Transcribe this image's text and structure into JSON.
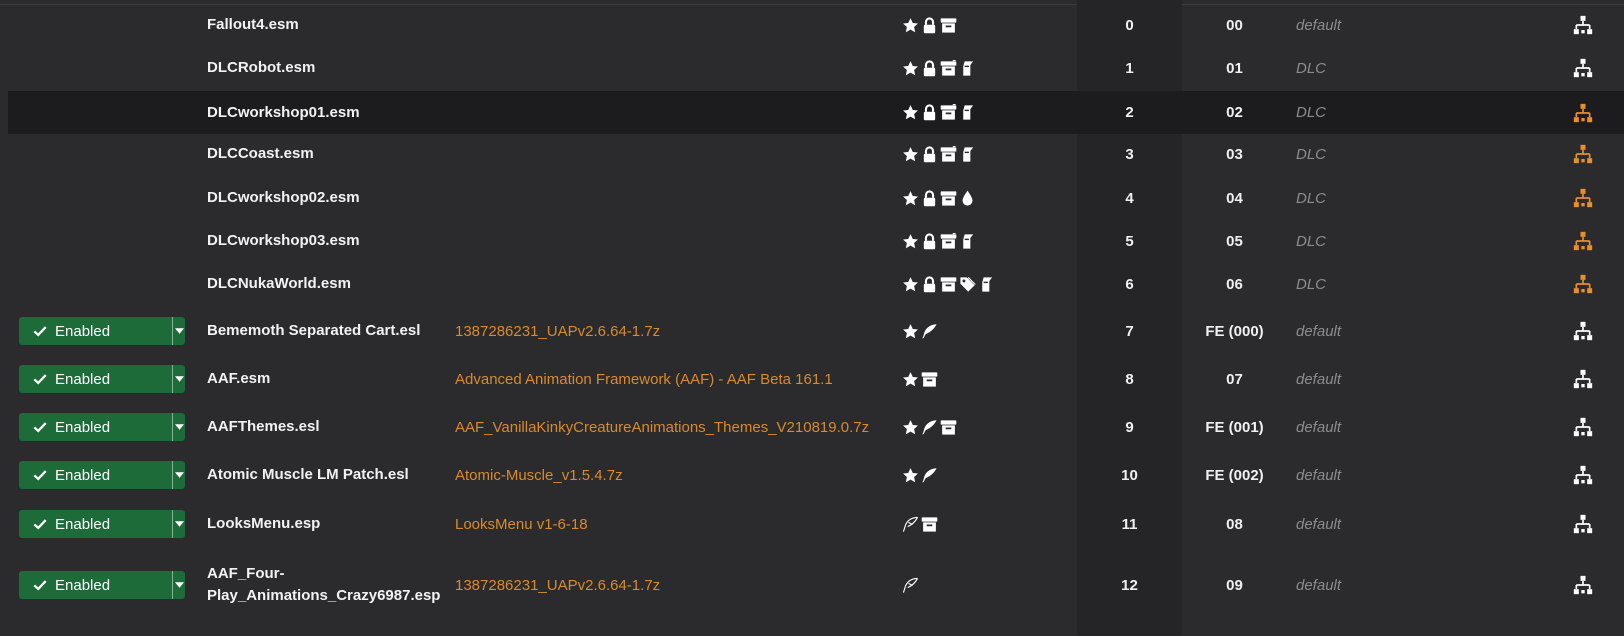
{
  "enabled_label": "Enabled",
  "colors": {
    "background": "#2b2b2e",
    "selected_row": "#1c1c1e",
    "enabled_green": "#1e6b3a",
    "mod_link": "#d98a2b",
    "group_text": "#8c8c8c",
    "tree_orange": "#e8902a"
  },
  "plugins": [
    {
      "status": "",
      "name": "Fallout4.esm",
      "mod": "",
      "flags": [
        "star-icon",
        "lock-icon",
        "archive-icon"
      ],
      "index": "0",
      "hex": "00",
      "group": "default",
      "tree_icon": "hierarchy-icon",
      "tree_color": "#ffffff",
      "selected": false
    },
    {
      "status": "",
      "name": "DLCRobot.esm",
      "mod": "",
      "flags": [
        "star-icon",
        "lock-icon",
        "archive-script-icon",
        "script-icon"
      ],
      "index": "1",
      "hex": "01",
      "group": "DLC",
      "tree_icon": "hierarchy-icon",
      "tree_color": "#ffffff",
      "selected": false
    },
    {
      "status": "",
      "name": "DLCworkshop01.esm",
      "mod": "",
      "flags": [
        "star-icon",
        "lock-icon",
        "archive-script-icon",
        "script-icon"
      ],
      "index": "2",
      "hex": "02",
      "group": "DLC",
      "tree_icon": "hierarchy-icon",
      "tree_color": "#e8902a",
      "selected": true
    },
    {
      "status": "",
      "name": "DLCCoast.esm",
      "mod": "",
      "flags": [
        "star-icon",
        "lock-icon",
        "archive-script-icon",
        "script-icon"
      ],
      "index": "3",
      "hex": "03",
      "group": "DLC",
      "tree_icon": "hierarchy-icon",
      "tree_color": "#e8902a",
      "selected": false
    },
    {
      "status": "",
      "name": "DLCworkshop02.esm",
      "mod": "",
      "flags": [
        "star-icon",
        "lock-icon",
        "archive-icon",
        "drop-icon"
      ],
      "index": "4",
      "hex": "04",
      "group": "DLC",
      "tree_icon": "hierarchy-icon",
      "tree_color": "#e8902a",
      "selected": false
    },
    {
      "status": "",
      "name": "DLCworkshop03.esm",
      "mod": "",
      "flags": [
        "star-icon",
        "lock-icon",
        "archive-script-icon",
        "script-icon"
      ],
      "index": "5",
      "hex": "05",
      "group": "DLC",
      "tree_icon": "hierarchy-icon",
      "tree_color": "#e8902a",
      "selected": false
    },
    {
      "status": "",
      "name": "DLCNukaWorld.esm",
      "mod": "",
      "flags": [
        "star-icon",
        "lock-icon",
        "archive-icon",
        "tag-icon",
        "script-icon"
      ],
      "index": "6",
      "hex": "06",
      "group": "DLC",
      "tree_icon": "hierarchy-icon",
      "tree_color": "#e8902a",
      "selected": false
    },
    {
      "status": "enabled",
      "name": "Bememoth Separated Cart.esl",
      "mod": "1387286231_UAPv2.6.64-1.7z",
      "flags": [
        "star-icon",
        "feather-icon"
      ],
      "index": "7",
      "hex": "FE (000)",
      "group": "default",
      "tree_icon": "hierarchy-icon",
      "tree_color": "#ffffff",
      "selected": false
    },
    {
      "status": "enabled",
      "name": "AAF.esm",
      "mod": "Advanced Animation Framework (AAF) - AAF Beta 161.1",
      "flags": [
        "star-icon",
        "archive-icon"
      ],
      "index": "8",
      "hex": "07",
      "group": "default",
      "tree_icon": "hierarchy-icon",
      "tree_color": "#ffffff",
      "selected": false
    },
    {
      "status": "enabled",
      "name": "AAFThemes.esl",
      "mod": "AAF_VanillaKinkyCreatureAnimations_Themes_V210819.0.7z",
      "flags": [
        "star-icon",
        "feather-icon",
        "archive-icon"
      ],
      "index": "9",
      "hex": "FE (001)",
      "group": "default",
      "tree_icon": "hierarchy-icon",
      "tree_color": "#ffffff",
      "selected": false
    },
    {
      "status": "enabled",
      "name": "Atomic Muscle LM Patch.esl",
      "mod": "Atomic-Muscle_v1.5.4.7z",
      "flags": [
        "star-icon",
        "feather-icon"
      ],
      "index": "10",
      "hex": "FE (002)",
      "group": "default",
      "tree_icon": "hierarchy-icon",
      "tree_color": "#ffffff",
      "selected": false
    },
    {
      "status": "enabled",
      "name": "LooksMenu.esp",
      "mod": "LooksMenu v1-6-18",
      "flags": [
        "feather-outline-icon",
        "archive-icon"
      ],
      "index": "11",
      "hex": "08",
      "group": "default",
      "tree_icon": "hierarchy-icon",
      "tree_color": "#ffffff",
      "selected": false
    },
    {
      "status": "enabled",
      "name": "AAF_Four-Play_Animations_Crazy6987.esp",
      "name_lines": [
        "AAF_Four-",
        "Play_Animations_Crazy6987.esp"
      ],
      "mod": "1387286231_UAPv2.6.64-1.7z",
      "flags": [
        "feather-outline-icon"
      ],
      "index": "12",
      "hex": "09",
      "group": "default",
      "tree_icon": "hierarchy-icon",
      "tree_color": "#ffffff",
      "selected": false
    }
  ]
}
